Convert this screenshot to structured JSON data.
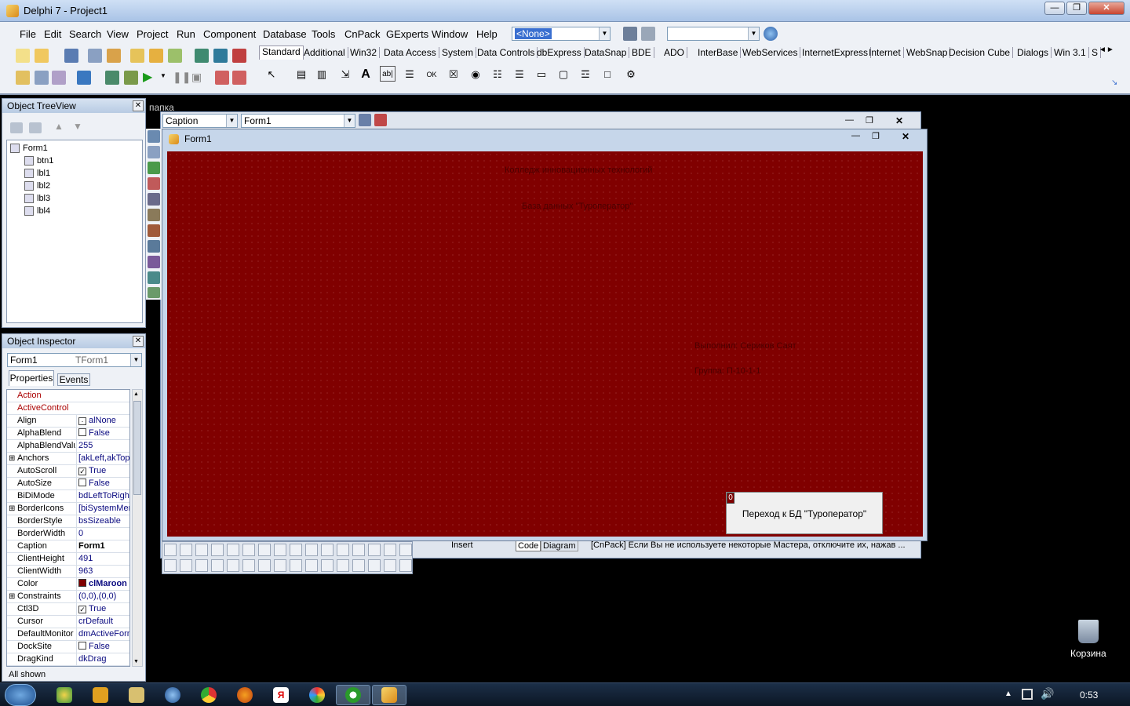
{
  "ide": {
    "title": "Delphi 7 - Project1",
    "menu": [
      "File",
      "Edit",
      "Search",
      "View",
      "Project",
      "Run",
      "Component",
      "Database",
      "Tools",
      "CnPack",
      "GExperts",
      "Window",
      "Help"
    ],
    "config_combo": "<None>",
    "second_combo": "",
    "palette_tabs": [
      "Standard",
      "Additional",
      "Win32",
      "Data Access",
      "System",
      "Data Controls",
      "dbExpress",
      "DataSnap",
      "BDE",
      "ADO",
      "InterBase",
      "WebServices",
      "InternetExpress",
      "Internet",
      "WebSnap",
      "Decision Cube",
      "Dialogs",
      "Win 3.1",
      "S"
    ],
    "palette_nav": "◄►"
  },
  "tree_view": {
    "title": "Object TreeView",
    "items": [
      "Form1",
      "btn1",
      "lbl1",
      "lbl2",
      "lbl3",
      "lbl4"
    ]
  },
  "inspector": {
    "title": "Object Inspector",
    "object_name": "Form1",
    "object_type": "TForm1",
    "tabs": [
      "Properties",
      "Events"
    ],
    "status": "All shown",
    "properties": [
      {
        "name": "Action",
        "value": ""
      },
      {
        "name": "ActiveControl",
        "value": ""
      },
      {
        "name": "Align",
        "value": "alNone"
      },
      {
        "name": "AlphaBlend",
        "value": "False"
      },
      {
        "name": "AlphaBlendValu",
        "value": "255"
      },
      {
        "name": "Anchors",
        "value": "[akLeft,akTop"
      },
      {
        "name": "AutoScroll",
        "value": "True"
      },
      {
        "name": "AutoSize",
        "value": "False"
      },
      {
        "name": "BiDiMode",
        "value": "bdLeftToRigh"
      },
      {
        "name": "BorderIcons",
        "value": "[biSystemMen"
      },
      {
        "name": "BorderStyle",
        "value": "bsSizeable"
      },
      {
        "name": "BorderWidth",
        "value": "0"
      },
      {
        "name": "Caption",
        "value": "Form1"
      },
      {
        "name": "ClientHeight",
        "value": "491"
      },
      {
        "name": "ClientWidth",
        "value": "963"
      },
      {
        "name": "Color",
        "value": "clMaroon"
      },
      {
        "name": "Constraints",
        "value": "(0,0),(0,0)"
      },
      {
        "name": "Ctl3D",
        "value": "True"
      },
      {
        "name": "Cursor",
        "value": "crDefault"
      },
      {
        "name": "DefaultMonitor",
        "value": "dmActiveForm"
      },
      {
        "name": "DockSite",
        "value": "False"
      },
      {
        "name": "DragKind",
        "value": "dkDrag"
      }
    ]
  },
  "editor": {
    "folder_label": "папка",
    "prop_combo": "Caption",
    "obj_combo": "Form1",
    "status_insert": "Insert",
    "tab_code": "Code",
    "tab_diagram": "Diagram",
    "status_message": "[CnPack] Если Вы не используете некоторые Мастера, отключите их, нажав ..."
  },
  "form": {
    "caption": "Form1",
    "color": "#800000",
    "labels": {
      "lbl1": "Колледж инновационных технологий",
      "lbl2": "База данных \"Туроператор\"",
      "lbl3": "Выполнил: Сериков Саят",
      "lbl4": "Группа: П-10-1-1"
    },
    "button_caption": "Переход к БД \"Туроператор\"",
    "button_marker": "0"
  },
  "desktop": {
    "recycle_bin": "Корзина",
    "clock": "0:53"
  }
}
